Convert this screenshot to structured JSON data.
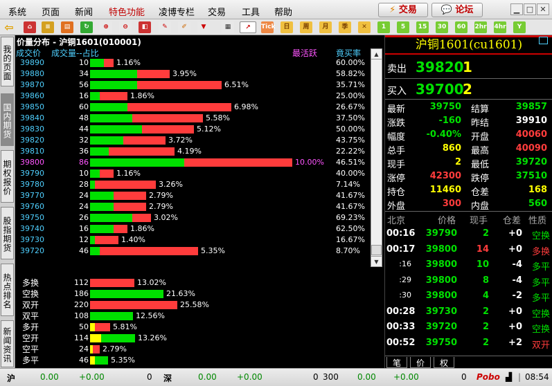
{
  "menu": [
    "系统",
    "页面",
    "新闻",
    "特色功能",
    "凌博专栏",
    "交易",
    "工具",
    "帮助"
  ],
  "menu_highlight": "特色功能",
  "top_buttons": {
    "trade": "交易",
    "forum": "论坛"
  },
  "toolbar_labels": {
    "tick": "Tick",
    "day": "日",
    "week": "周",
    "month": "月",
    "season": "季",
    "m1": "1",
    "m5": "5",
    "m15": "15",
    "m30": "30",
    "m60": "60",
    "h2": "2hr",
    "h4": "4hr",
    "y": "Y"
  },
  "side_tabs": [
    "我的页面",
    "国内期货",
    "期权报价",
    "股指期货",
    "热点排名",
    "新闻资讯"
  ],
  "panel": {
    "title": "价量分布 - 沪铜1601(010001)",
    "col_price": "成交价",
    "col_vol": "成交量--占比",
    "col_active": "最活跃",
    "col_ratio": "竟买率"
  },
  "price_rows": [
    {
      "price": "39890",
      "vol": "10",
      "pct": "1.16%",
      "ratio": "60.00%",
      "g": 0.6,
      "t": 0.116
    },
    {
      "price": "39880",
      "vol": "34",
      "pct": "3.95%",
      "ratio": "58.82%",
      "g": 0.588,
      "t": 0.395
    },
    {
      "price": "39870",
      "vol": "56",
      "pct": "6.51%",
      "ratio": "35.71%",
      "g": 0.357,
      "t": 0.651
    },
    {
      "price": "39860",
      "vol": "16",
      "pct": "1.86%",
      "ratio": "25.00%",
      "g": 0.25,
      "t": 0.186
    },
    {
      "price": "39850",
      "vol": "60",
      "pct": "6.98%",
      "ratio": "26.67%",
      "g": 0.267,
      "t": 0.698
    },
    {
      "price": "39840",
      "vol": "48",
      "pct": "5.58%",
      "ratio": "37.50%",
      "g": 0.375,
      "t": 0.558
    },
    {
      "price": "39830",
      "vol": "44",
      "pct": "5.12%",
      "ratio": "50.00%",
      "g": 0.5,
      "t": 0.512
    },
    {
      "price": "39820",
      "vol": "32",
      "pct": "3.72%",
      "ratio": "43.75%",
      "g": 0.4375,
      "t": 0.372
    },
    {
      "price": "39810",
      "vol": "36",
      "pct": "4.19%",
      "ratio": "22.22%",
      "g": 0.2222,
      "t": 0.419
    },
    {
      "price": "39800",
      "vol": "86",
      "pct": "10.00%",
      "ratio": "46.51%",
      "g": 0.4651,
      "t": 1.0,
      "active": true
    },
    {
      "price": "39790",
      "vol": "10",
      "pct": "1.16%",
      "ratio": "40.00%",
      "g": 0.4,
      "t": 0.116
    },
    {
      "price": "39780",
      "vol": "28",
      "pct": "3.26%",
      "ratio": "7.14%",
      "g": 0.0714,
      "t": 0.326
    },
    {
      "price": "39770",
      "vol": "24",
      "pct": "2.79%",
      "ratio": "41.67%",
      "g": 0.4167,
      "t": 0.279
    },
    {
      "price": "39760",
      "vol": "24",
      "pct": "2.79%",
      "ratio": "41.67%",
      "g": 0.4167,
      "t": 0.279
    },
    {
      "price": "39750",
      "vol": "26",
      "pct": "3.02%",
      "ratio": "69.23%",
      "g": 0.6923,
      "t": 0.302
    },
    {
      "price": "39740",
      "vol": "16",
      "pct": "1.86%",
      "ratio": "62.50%",
      "g": 0.625,
      "t": 0.186
    },
    {
      "price": "39730",
      "vol": "12",
      "pct": "1.40%",
      "ratio": "16.67%",
      "g": 0.1667,
      "t": 0.14
    },
    {
      "price": "39720",
      "vol": "46",
      "pct": "5.35%",
      "ratio": "8.70%",
      "g": 0.087,
      "t": 0.535
    }
  ],
  "type_rows": [
    {
      "name": "多换",
      "vol": "112",
      "pct": "13.02%",
      "color": "#ff3c3c",
      "t": 0.1302
    },
    {
      "name": "空换",
      "vol": "186",
      "pct": "21.63%",
      "color": "#00e000",
      "t": 0.2163
    },
    {
      "name": "双开",
      "vol": "220",
      "pct": "25.58%",
      "color": "#ff3c3c",
      "t": 0.2558
    },
    {
      "name": "双平",
      "vol": "108",
      "pct": "12.56%",
      "color": "#00e000",
      "t": 0.1256
    },
    {
      "name": "多开",
      "vol": "50",
      "pct": "5.81%",
      "color": "#ff3c3c",
      "t": 0.0581
    },
    {
      "name": "空开",
      "vol": "114",
      "pct": "13.26%",
      "color": "#00e000",
      "t": 0.1326
    },
    {
      "name": "空平",
      "vol": "24",
      "pct": "2.79%",
      "color": "#ff3c3c",
      "t": 0.0279
    },
    {
      "name": "多平",
      "vol": "46",
      "pct": "5.35%",
      "color": "#00e000",
      "t": 0.0535
    }
  ],
  "quote": {
    "symbol": "沪铜1601(cu1601)",
    "sell_label": "卖出",
    "sell_price": "39820",
    "sell_vol": "1",
    "buy_label": "买入",
    "buy_price": "39700",
    "buy_vol": "2",
    "fields": [
      {
        "l1": "最新",
        "v1": "39750",
        "c1": "grn",
        "l2": "结算",
        "v2": "39857",
        "c2": "grn"
      },
      {
        "l1": "涨跌",
        "v1": "-160",
        "c1": "grn",
        "l2": "昨结",
        "v2": "39910",
        "c2": "wht"
      },
      {
        "l1": "幅度",
        "v1": "-0.40%",
        "c1": "grn",
        "l2": "开盘",
        "v2": "40060",
        "c2": "red"
      },
      {
        "l1": "总手",
        "v1": "860",
        "c1": "yel",
        "l2": "最高",
        "v2": "40090",
        "c2": "red"
      },
      {
        "l1": "现手",
        "v1": "2",
        "c1": "yel",
        "l2": "最低",
        "v2": "39720",
        "c2": "grn"
      },
      {
        "l1": "涨停",
        "v1": "42300",
        "c1": "red",
        "l2": "跌停",
        "v2": "37510",
        "c2": "grn"
      },
      {
        "l1": "持仓",
        "v1": "11460",
        "c1": "yel",
        "l2": "仓差",
        "v2": "168",
        "c2": "yel"
      },
      {
        "l1": "外盘",
        "v1": "300",
        "c1": "red",
        "l2": "内盘",
        "v2": "560",
        "c2": "grn"
      }
    ],
    "tick_header": {
      "time": "北京",
      "price": "价格",
      "vol": "现手",
      "oi": "仓差",
      "nature": "性质"
    },
    "ticks": [
      {
        "time": "00:16",
        "price": "39790",
        "vol": "2",
        "oi": "+0",
        "nature": "空换",
        "pc": "grn",
        "vc": "grn",
        "nc": "grn"
      },
      {
        "time": "00:17",
        "price": "39800",
        "vol": "14",
        "oi": "+0",
        "nature": "多换",
        "pc": "grn",
        "vc": "red",
        "nc": "red"
      },
      {
        "time": ":16",
        "price": "39800",
        "vol": "10",
        "oi": "-4",
        "nature": "多平",
        "pc": "grn",
        "vc": "grn",
        "nc": "grn"
      },
      {
        "time": ":29",
        "price": "39800",
        "vol": "8",
        "oi": "-4",
        "nature": "多平",
        "pc": "grn",
        "vc": "grn",
        "nc": "grn"
      },
      {
        "time": ":30",
        "price": "39800",
        "vol": "4",
        "oi": "-2",
        "nature": "多平",
        "pc": "grn",
        "vc": "grn",
        "nc": "grn"
      },
      {
        "time": "00:28",
        "price": "39730",
        "vol": "2",
        "oi": "+0",
        "nature": "空换",
        "pc": "grn",
        "vc": "grn",
        "nc": "grn"
      },
      {
        "time": "00:33",
        "price": "39720",
        "vol": "2",
        "oi": "+0",
        "nature": "空换",
        "pc": "grn",
        "vc": "grn",
        "nc": "grn"
      },
      {
        "time": "00:52",
        "price": "39750",
        "vol": "2",
        "oi": "+2",
        "nature": "双开",
        "pc": "grn",
        "vc": "grn",
        "nc": "red"
      }
    ],
    "bottom_tabs": [
      "笔",
      "价",
      "权"
    ]
  },
  "status": {
    "sh": "沪",
    "sh_v1": "0.00",
    "sh_v2": "+0.00",
    "sh_v3": "0",
    "sz": "深",
    "sz_v1": "0.00",
    "sz_v2": "+0.00",
    "sz_v3": "0",
    "v300": "300",
    "v300_1": "0.00",
    "v300_2": "+0.00",
    "v300_3": "0",
    "brand": "Pobo",
    "time": "08:54"
  }
}
